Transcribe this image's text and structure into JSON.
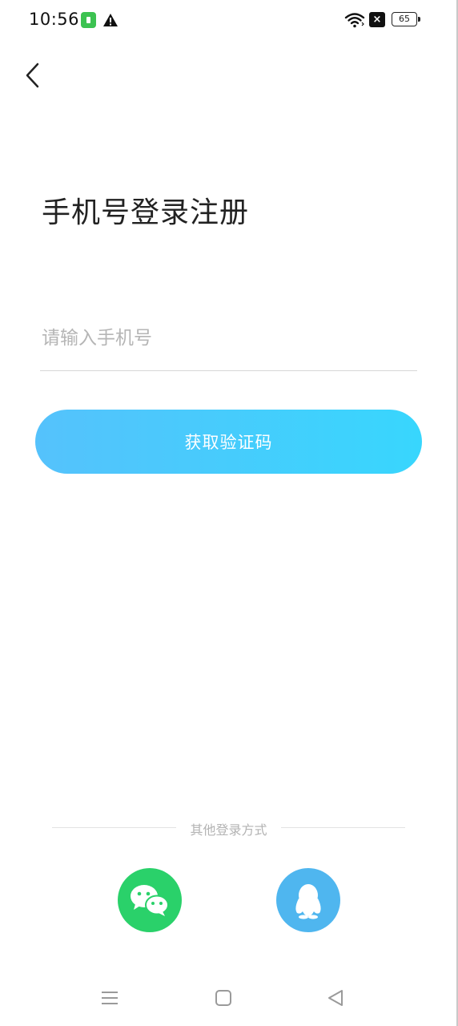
{
  "status_bar": {
    "time": "10:56",
    "battery_level": "65",
    "notification_mark": "×"
  },
  "icons": {
    "back": "chevron-left-icon",
    "wifi": "wifi-icon",
    "warning": "warning-icon",
    "wechat": "wechat-icon",
    "qq": "qq-penguin-icon"
  },
  "page": {
    "title": "手机号登录注册",
    "phone_placeholder": "请输入手机号",
    "phone_value": "",
    "get_code_label": "获取验证码"
  },
  "other_login": {
    "label": "其他登录方式"
  },
  "colors": {
    "button_gradient_start": "#55c2fc",
    "button_gradient_end": "#38d6fd",
    "wechat_green": "#2ad16a",
    "qq_blue": "#4fb6ef"
  }
}
